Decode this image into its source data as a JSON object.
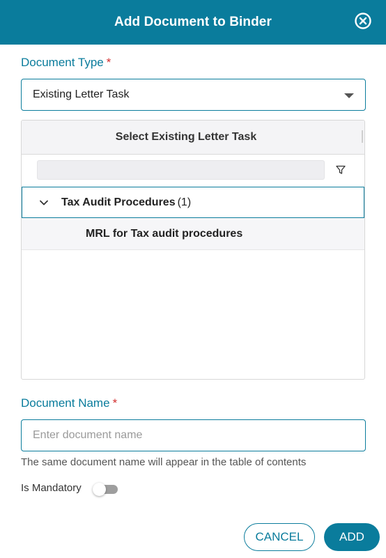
{
  "dialog": {
    "title": "Add Document to Binder"
  },
  "document_type": {
    "label": "Document Type",
    "required_mark": "*",
    "selected": "Existing Letter Task"
  },
  "grid": {
    "header": "Select Existing Letter Task",
    "group": {
      "label": "Tax Audit Procedures",
      "count": "(1)"
    },
    "items": [
      {
        "label": "MRL for Tax audit procedures"
      }
    ]
  },
  "document_name": {
    "label": "Document Name",
    "required_mark": "*",
    "value": "",
    "placeholder": "Enter document name",
    "helper": "The same document name will appear in the table of contents"
  },
  "mandatory": {
    "label": "Is Mandatory",
    "on": false
  },
  "actions": {
    "cancel": "CANCEL",
    "add": "ADD"
  },
  "colors": {
    "accent": "#0a7c9c",
    "required": "#d32f2f"
  }
}
